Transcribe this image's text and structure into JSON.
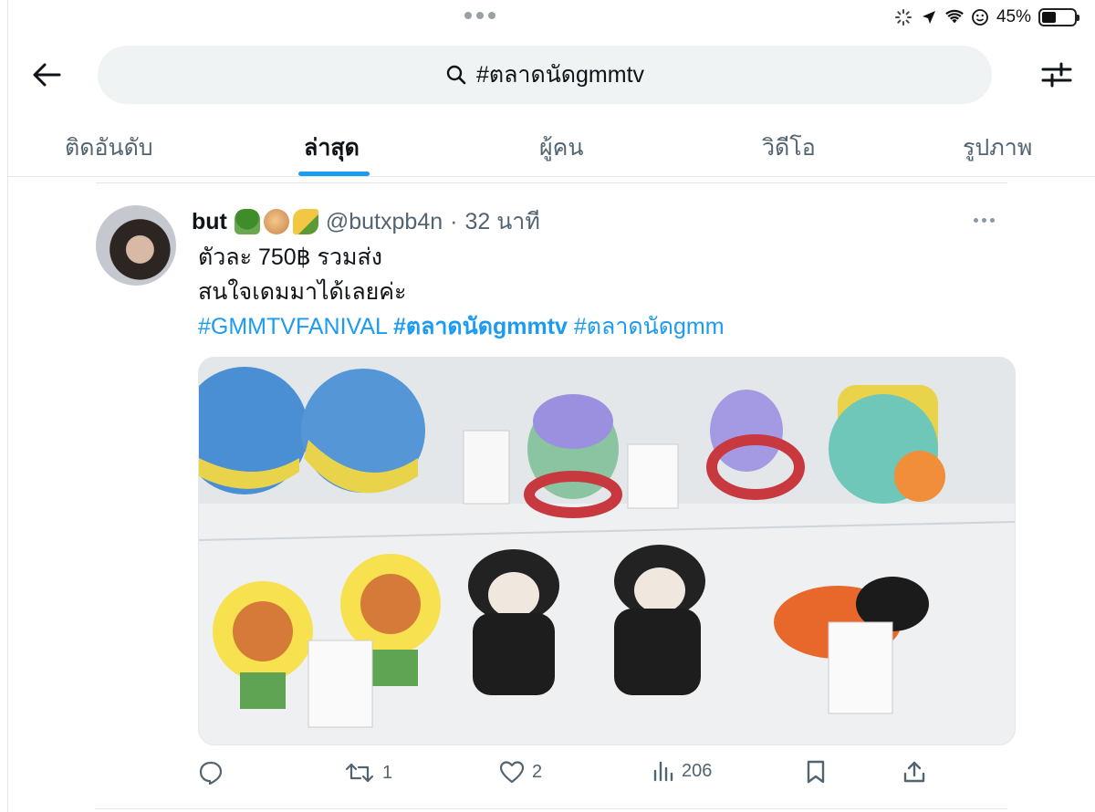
{
  "status_bar": {
    "battery": "45%",
    "battery_level": 0.45
  },
  "header": {
    "search_query": "#ตลาดนัดgmmtv"
  },
  "tabs": [
    {
      "label": "ติดอันดับ",
      "active": false
    },
    {
      "label": "ล่าสุด",
      "active": true
    },
    {
      "label": "ผู้คน",
      "active": false
    },
    {
      "label": "วิดีโอ",
      "active": false
    },
    {
      "label": "รูปภาพ",
      "active": false
    }
  ],
  "tweet": {
    "name": "but",
    "name_emojis": [
      "broccoli",
      "onion",
      "corn"
    ],
    "handle": "@butxpb4n",
    "separator": "·",
    "time": "32 นาที",
    "lines": [
      "ตัวละ 750฿ รวมส่ง",
      "สนใจเดมมาได้เลยค่ะ"
    ],
    "hashtags": [
      "#GMMTVFANIVAL",
      "#ตลาดนัดgmmtv",
      "#ตลาดนัดgmm"
    ],
    "media_description_icons": "plush-keychains-photo",
    "stats": {
      "replies": "",
      "retweets": "1",
      "likes": "2",
      "views": "206"
    }
  },
  "colors": {
    "accent": "#1d9bf0",
    "text": "#0f1419",
    "muted": "#536471",
    "search_bg": "#eff3f4"
  }
}
